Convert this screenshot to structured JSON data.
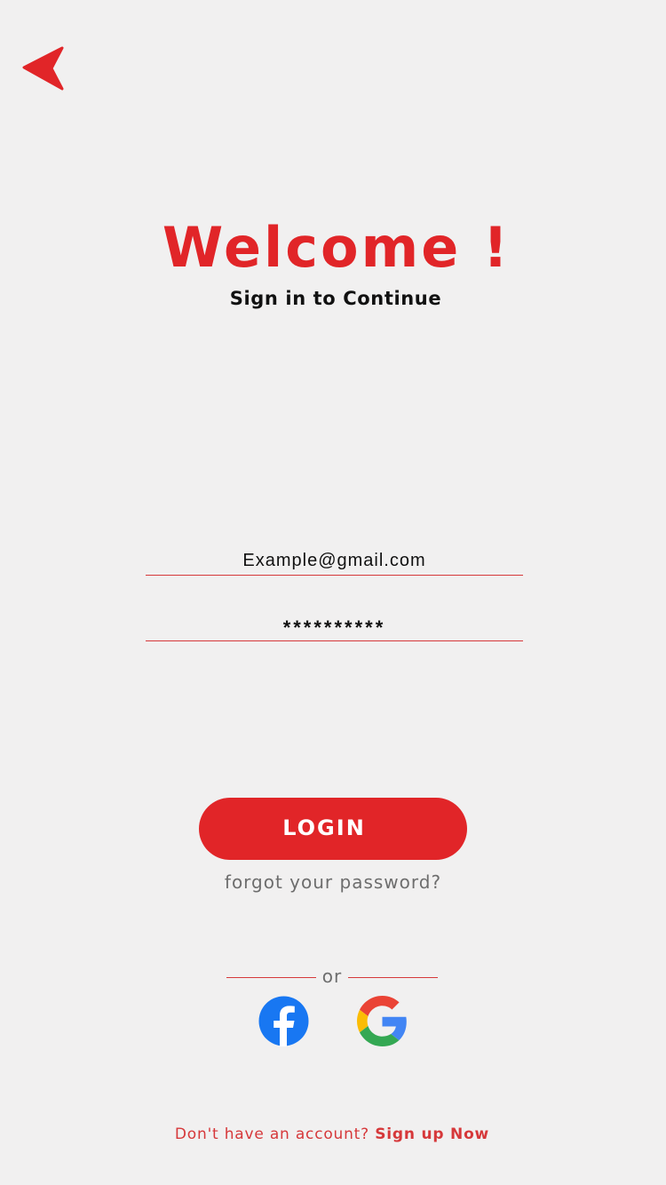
{
  "header": {
    "back_icon": "back-arrow-icon",
    "accent_color": "#e12528"
  },
  "hero": {
    "title": "Welcome !",
    "subtitle": "Sign in to Continue"
  },
  "form": {
    "email_value": "Example@gmail.com",
    "password_value": "**********",
    "login_label": "LOGIN",
    "forgot_label": "forgot your password?"
  },
  "social": {
    "divider_label": "or",
    "providers": [
      {
        "name": "facebook",
        "icon": "facebook-icon"
      },
      {
        "name": "google",
        "icon": "google-icon"
      }
    ]
  },
  "footer": {
    "prompt": "Don't have an account?",
    "signup_label": "Sign up Now"
  },
  "colors": {
    "background": "#f1f0f0",
    "primary": "#e12528",
    "facebook_blue": "#1877f2"
  }
}
